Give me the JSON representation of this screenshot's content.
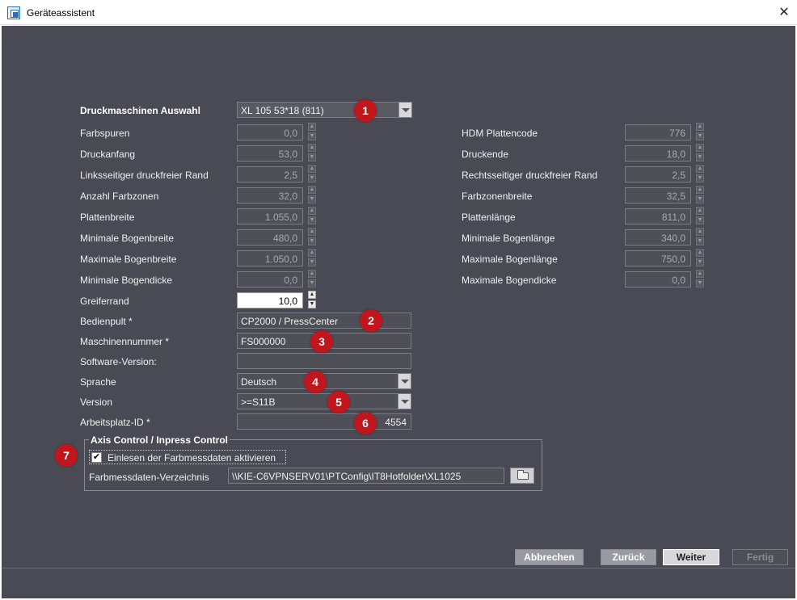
{
  "window": {
    "title": "Geräteassistent",
    "close_glyph": "✕"
  },
  "main": {
    "machine_select": {
      "label": "Druckmaschinen Auswahl",
      "value": "XL 105 53*18 (811)"
    },
    "left_fields": [
      {
        "label": "Farbspuren",
        "value": "0,0"
      },
      {
        "label": "Druckanfang",
        "value": "53,0"
      },
      {
        "label": "Linksseitiger druckfreier Rand",
        "value": "2,5"
      },
      {
        "label": "Anzahl Farbzonen",
        "value": "32,0"
      },
      {
        "label": "Plattenbreite",
        "value": "1.055,0"
      },
      {
        "label": "Minimale Bogenbreite",
        "value": "480,0"
      },
      {
        "label": "Maximale Bogenbreite",
        "value": "1.050,0"
      },
      {
        "label": "Minimale Bogendicke",
        "value": "0,0"
      },
      {
        "label": "Greiferrand",
        "value": "10,0"
      }
    ],
    "right_fields": [
      {
        "label": "HDM Plattencode",
        "value": "776"
      },
      {
        "label": "Druckende",
        "value": "18,0"
      },
      {
        "label": "Rechtsseitiger druckfreier Rand",
        "value": "2,5"
      },
      {
        "label": "Farbzonenbreite",
        "value": "32,5"
      },
      {
        "label": "Plattenlänge",
        "value": "811,0"
      },
      {
        "label": "Minimale Bogenlänge",
        "value": "340,0"
      },
      {
        "label": "Maximale Bogenlänge",
        "value": "750,0"
      },
      {
        "label": "Maximale Bogendicke",
        "value": "0,0"
      }
    ],
    "bedienpult": {
      "label": "Bedienpult *",
      "value": "CP2000 / PressCenter"
    },
    "maschinennummer": {
      "label": "Maschinennummer *",
      "value": "FS000000"
    },
    "software_version": {
      "label": "Software-Version:",
      "value": ""
    },
    "sprache": {
      "label": "Sprache",
      "value": "Deutsch"
    },
    "version": {
      "label": "Version",
      "value": ">=S11B"
    },
    "arbeitsplatz": {
      "label": "Arbeitsplatz-ID *",
      "value": "4554"
    }
  },
  "axis_control": {
    "title": "Axis Control / Inpress Control",
    "checkbox_label": "Einlesen der Farbmessdaten aktivieren",
    "checked": true,
    "check_glyph": "✔",
    "dir_label": "Farbmessdaten-Verzeichnis",
    "dir_value": "\\\\KIE-C6VPNSERV01\\PTConfig\\IT8Hotfolder\\XL1025"
  },
  "badges": [
    "1",
    "2",
    "3",
    "4",
    "5",
    "6",
    "7"
  ],
  "footer": {
    "cancel": "Abbrechen",
    "back": "Zurück",
    "next": "Weiter",
    "finish": "Fertig"
  },
  "colors": {
    "panel_bg": "#4a4a54",
    "badge_red": "#c0161c",
    "input_border": "#7c7c84"
  },
  "icons": {
    "spin_up": "▲",
    "spin_down": "▼",
    "app": "device-wizard-icon",
    "folder": "folder-icon"
  }
}
